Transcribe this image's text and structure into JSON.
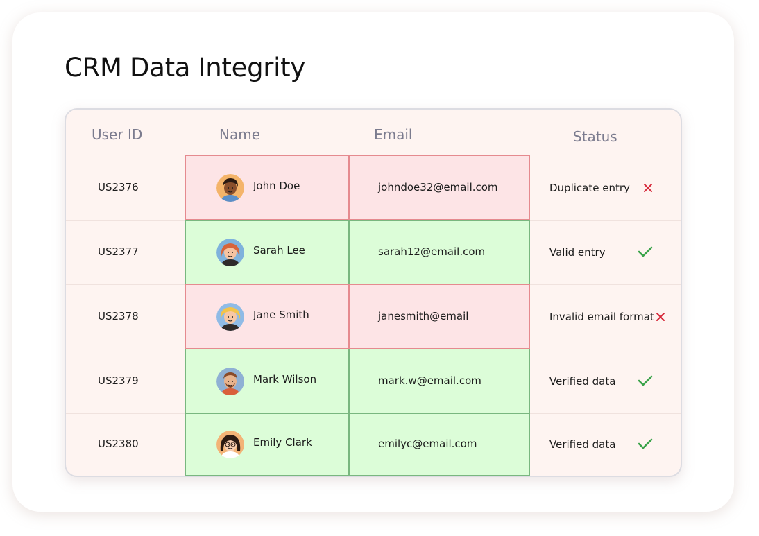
{
  "title": "CRM Data Integrity",
  "columns": [
    "User ID",
    "Name",
    "Email",
    "Status"
  ],
  "rows": [
    {
      "id": "US2376",
      "name": "John Doe",
      "email": "johndoe32@email.com",
      "status": "Duplicate entry",
      "result": "error",
      "avatar": "avatar-dark-curly-hair"
    },
    {
      "id": "US2377",
      "name": "Sarah Lee",
      "email": "sarah12@email.com",
      "status": "Valid entry",
      "result": "valid",
      "avatar": "avatar-red-hair"
    },
    {
      "id": "US2378",
      "name": "Jane Smith",
      "email": "janesmith@email",
      "status": "Invalid email format",
      "result": "error",
      "avatar": "avatar-blonde-curly-hair"
    },
    {
      "id": "US2379",
      "name": "Mark Wilson",
      "email": "mark.w@email.com",
      "status": "Verified data",
      "result": "valid",
      "avatar": "avatar-bearded-man"
    },
    {
      "id": "US2380",
      "name": "Emily Clark",
      "email": "emilyc@email.com",
      "status": "Verified data",
      "result": "valid",
      "avatar": "avatar-bangs-glasses"
    }
  ],
  "colors": {
    "error_fill": "#fde4e6",
    "error_border": "#e58a8f",
    "valid_fill": "#dcfdd8",
    "valid_border": "#79b77f",
    "error_icon": "#d6283a",
    "valid_icon": "#3aa34a"
  }
}
